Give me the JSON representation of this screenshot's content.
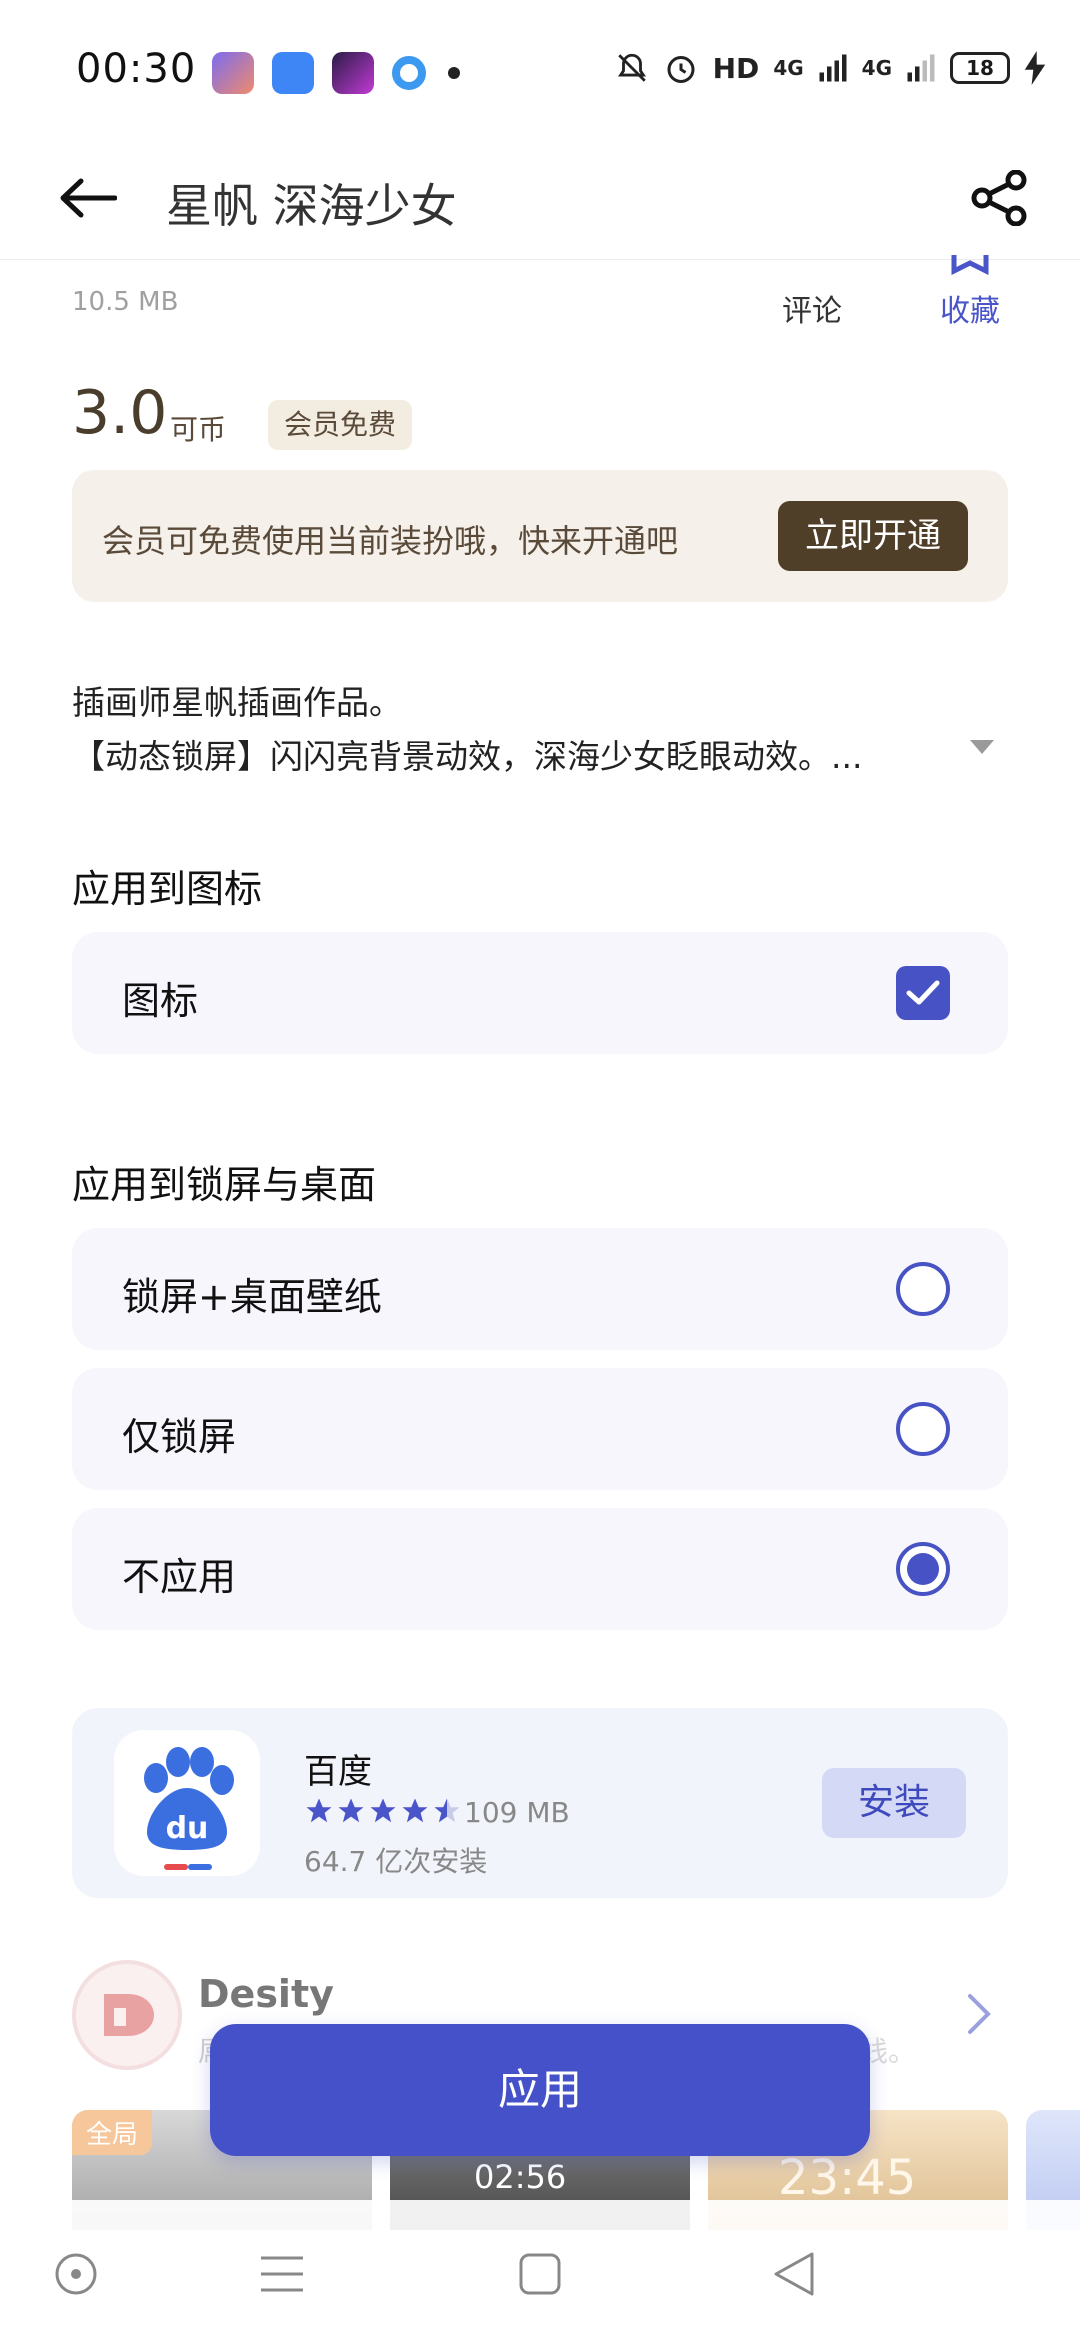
{
  "status_bar": {
    "time": "00:30",
    "hd_label": "HD",
    "network1": "4G",
    "network2": "4G",
    "battery": "18"
  },
  "header": {
    "title": "星帆 深海少女",
    "back_icon": "arrow-left-icon",
    "share_icon": "share-icon"
  },
  "info": {
    "file_size": "10.5 MB",
    "comment_label": "评论",
    "favorite_label": "收藏"
  },
  "price": {
    "value": "3.0",
    "unit": "可币",
    "badge": "会员免费"
  },
  "vip_banner": {
    "text": "会员可免费使用当前装扮哦，快来开通吧",
    "button": "立即开通"
  },
  "description": {
    "line1": "插画师星帆插画作品。",
    "line2": "【动态锁屏】闪闪亮背景动效，深海少女眨眼动效。..."
  },
  "icon_section": {
    "title": "应用到图标",
    "option_label": "图标",
    "checked": true
  },
  "lock_section": {
    "title": "应用到锁屏与桌面",
    "options": [
      {
        "label": "锁屏+桌面壁纸",
        "selected": false
      },
      {
        "label": "仅锁屏",
        "selected": false
      },
      {
        "label": "不应用",
        "selected": true
      }
    ]
  },
  "ad": {
    "title": "百度",
    "rating": 4.5,
    "size": "109 MB",
    "installs": "64.7 亿次安装",
    "button": "安装"
  },
  "desity": {
    "title": "Desity",
    "subtitle_left": "屌",
    "subtitle_right": "线。"
  },
  "preview": {
    "badge": "全局",
    "time1": "02:56",
    "time2": "23:45"
  },
  "apply_button": "应用",
  "colors": {
    "accent": "#4551c8",
    "brown": "#4f3e28",
    "card_bg": "#f6f6fc"
  }
}
